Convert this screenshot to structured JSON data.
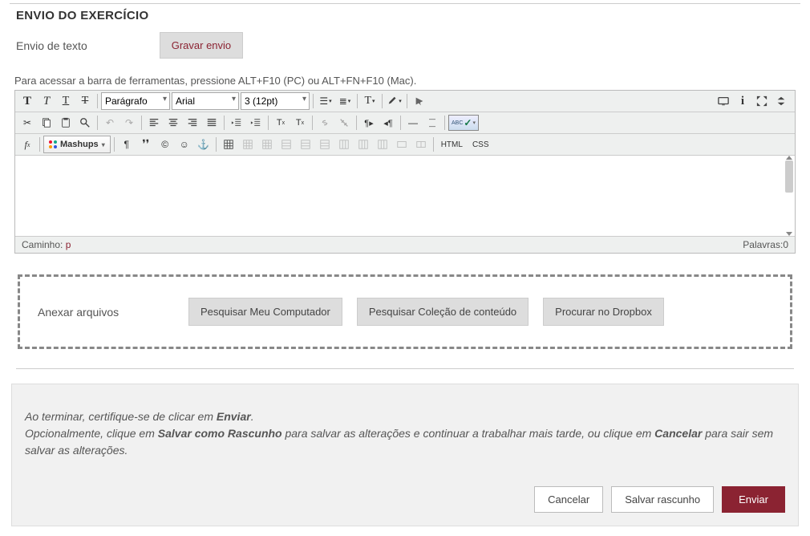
{
  "section_title": "ENVIO DO EXERCÍCIO",
  "text_submit_label": "Envio de texto",
  "record_btn": "Gravar envio",
  "toolbar_hint": "Para acessar a barra de ferramentas, pressione ALT+F10 (PC) ou ALT+FN+F10 (Mac).",
  "selects": {
    "block": "Parágrafo",
    "font": "Arial",
    "size": "3 (12pt)"
  },
  "mashups_label": "Mashups",
  "html_label": "HTML",
  "css_label": "CSS",
  "status": {
    "path_label": "Caminho: ",
    "path_value": "p",
    "words_label": "Palavras:",
    "words_count": "0"
  },
  "attach": {
    "label": "Anexar arquivos",
    "browse_computer": "Pesquisar Meu Computador",
    "browse_content": "Pesquisar Coleção de conteúdo",
    "browse_dropbox": "Procurar no Dropbox"
  },
  "footer": {
    "line1a": "Ao terminar, certifique-se de clicar em ",
    "line1b": "Enviar",
    "line1c": ".",
    "line2a": "Opcionalmente, clique em ",
    "line2b": "Salvar como Rascunho",
    "line2c": " para salvar as alterações e continuar a trabalhar mais tarde, ou clique em ",
    "line2d": "Cancelar",
    "line2e": " para sair sem salvar as alterações.",
    "cancel_btn": "Cancelar",
    "draft_btn": "Salvar rascunho",
    "submit_btn": "Enviar"
  }
}
